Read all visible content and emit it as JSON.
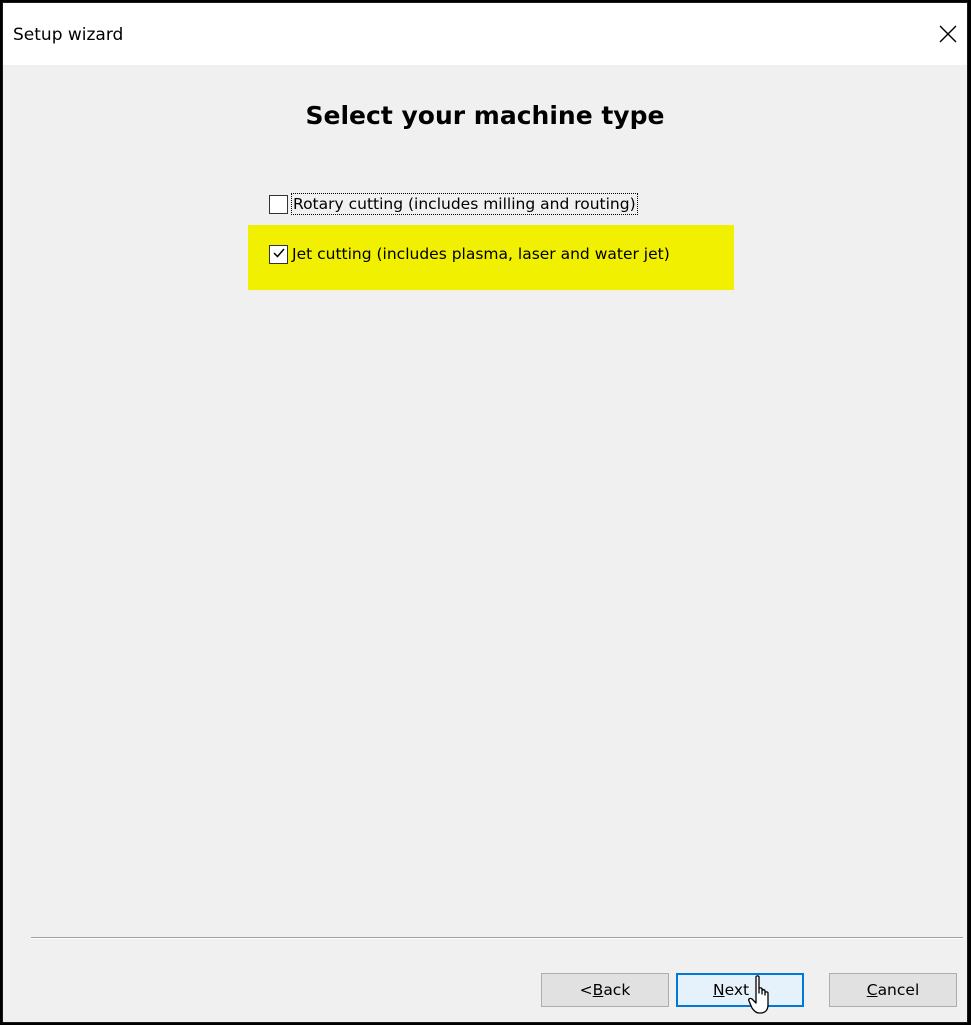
{
  "window": {
    "title": "Setup wizard"
  },
  "heading": "Select your machine type",
  "options": [
    {
      "label": "Rotary cutting (includes milling and routing)",
      "checked": false
    },
    {
      "label": "Jet cutting (includes plasma, laser and water jet)",
      "checked": true
    }
  ],
  "buttons": {
    "back_prefix": "< ",
    "back_access_key": "B",
    "back_rest": "ack",
    "next_access_key": "N",
    "next_rest": "ext >",
    "cancel_access_key": "C",
    "cancel_rest": "ancel"
  },
  "colors": {
    "highlight": "#f0f000",
    "window_bg": "#f0f0f0",
    "focus_border": "#0078d7"
  },
  "icons": {
    "close": "close-icon",
    "checkmark": "checkmark-icon",
    "cursor": "hand-pointer-icon"
  }
}
